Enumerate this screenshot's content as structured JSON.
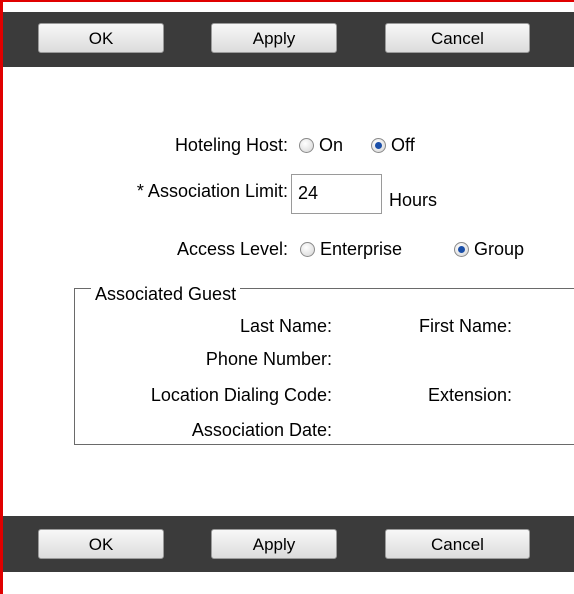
{
  "toolbar_top": {
    "ok_label": "OK",
    "apply_label": "Apply",
    "cancel_label": "Cancel"
  },
  "toolbar_bottom": {
    "ok_label": "OK",
    "apply_label": "Apply",
    "cancel_label": "Cancel"
  },
  "form": {
    "hoteling_host": {
      "label": "Hoteling Host:",
      "options": [
        {
          "label": "On",
          "checked": false
        },
        {
          "label": "Off",
          "checked": true
        }
      ]
    },
    "association_limit": {
      "label": "* Association Limit:",
      "value": "24",
      "unit": "Hours"
    },
    "access_level": {
      "label": "Access Level:",
      "options": [
        {
          "label": "Enterprise",
          "checked": false
        },
        {
          "label": "Group",
          "checked": true
        }
      ]
    }
  },
  "associated_guest": {
    "legend": "Associated Guest",
    "last_name_label": "Last Name:",
    "first_name_label": "First Name:",
    "phone_number_label": "Phone Number:",
    "location_dialing_code_label": "Location Dialing Code:",
    "extension_label": "Extension:",
    "association_date_label": "Association Date:"
  },
  "colors": {
    "frame_red": "#e00000",
    "toolbar_bg": "#3b3b3b",
    "radio_selected": "#1b4fa8"
  }
}
